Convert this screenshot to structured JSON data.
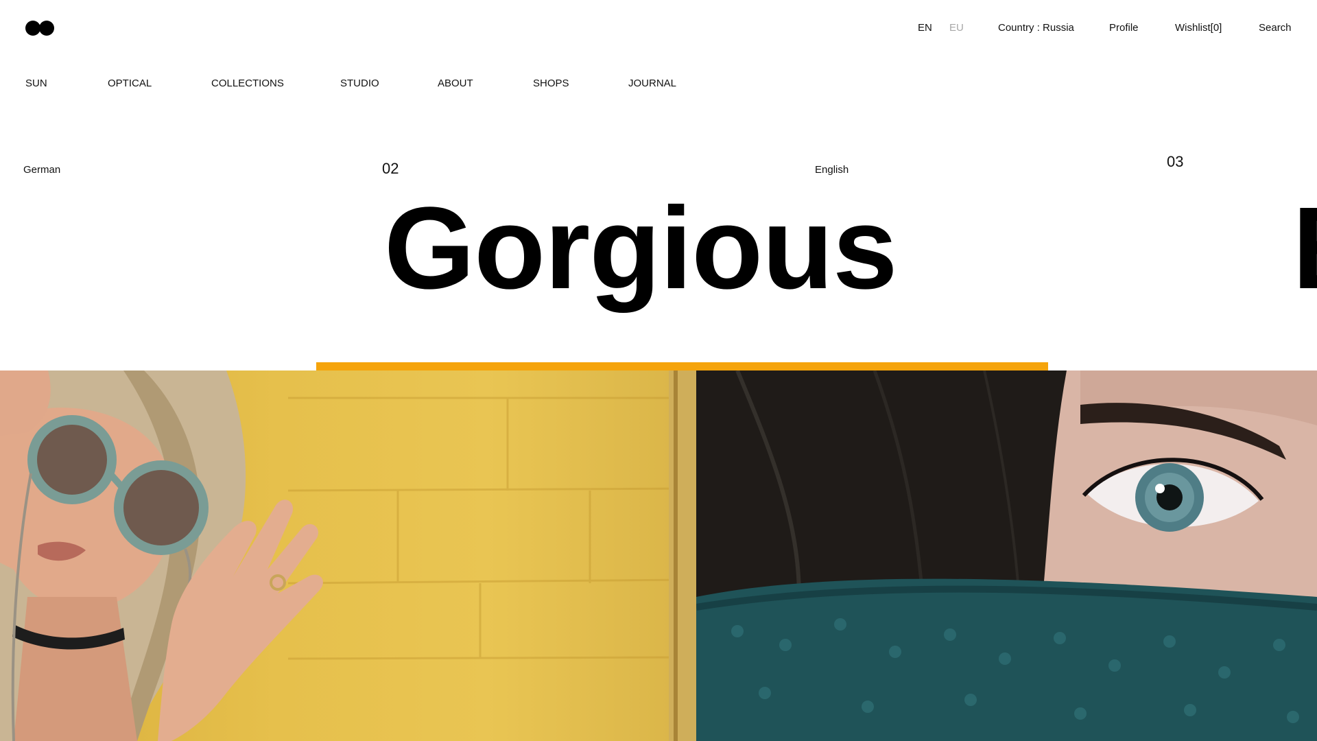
{
  "header": {
    "languages": [
      "EN",
      "EU"
    ],
    "country": "Country : Russia",
    "profile": "Profile",
    "wishlist": "Wishlist[0]",
    "search": "Search"
  },
  "nav": {
    "items": [
      "SUN",
      "OPTICAL",
      "COLLECTIONS",
      "STUDIO",
      "ABOUT",
      "SHOPS",
      "JOURNAL"
    ]
  },
  "slider": {
    "prev": {
      "language": "German"
    },
    "current": {
      "number": "02",
      "word": "Gorgious",
      "language": "English"
    },
    "next": {
      "number": "03"
    }
  },
  "colors": {
    "accent": "#f5a40c",
    "text": "#111111",
    "muted": "#a7a7a7"
  },
  "icons": {
    "logo": "two-circles-logo"
  }
}
